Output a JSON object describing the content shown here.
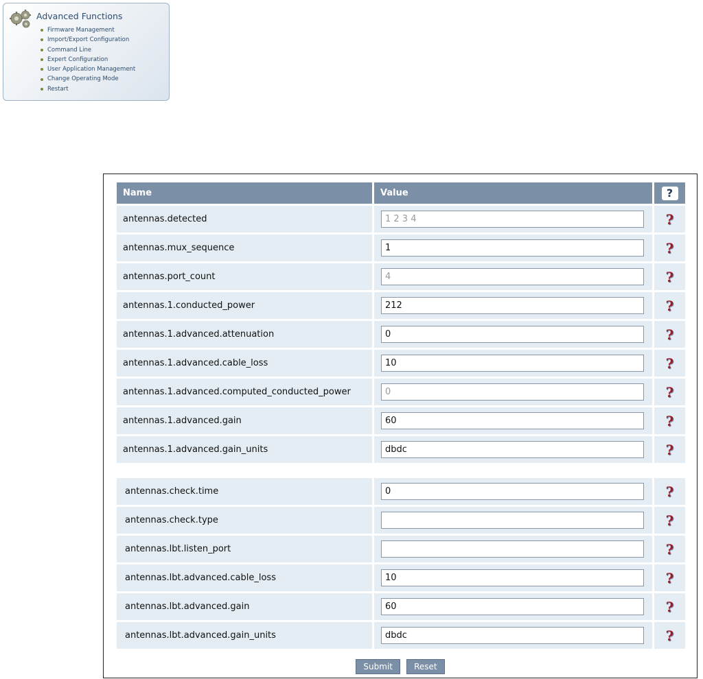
{
  "advanced_functions": {
    "title": "Advanced Functions",
    "items": [
      "Firmware Management",
      "Import/Export Configuration",
      "Command Line",
      "Expert Configuration",
      "User Application Management",
      "Change Operating Mode",
      "Restart"
    ],
    "icon": "gear-icon"
  },
  "table": {
    "headers": {
      "name": "Name",
      "value": "Value",
      "help": "?"
    },
    "rows": [
      {
        "name": "antennas.detected",
        "value": "1 2 3 4",
        "readonly": true
      },
      {
        "name": "antennas.mux_sequence",
        "value": "1",
        "readonly": false
      },
      {
        "name": "antennas.port_count",
        "value": "4",
        "readonly": true
      },
      {
        "name": "antennas.1.conducted_power",
        "value": "212",
        "readonly": false
      },
      {
        "name": "antennas.1.advanced.attenuation",
        "value": "0",
        "readonly": false
      },
      {
        "name": "antennas.1.advanced.cable_loss",
        "value": "10",
        "readonly": false
      },
      {
        "name": "antennas.1.advanced.computed_conducted_power",
        "value": "0",
        "readonly": true
      },
      {
        "name": "antennas.1.advanced.gain",
        "value": "60",
        "readonly": false
      },
      {
        "name": "antennas.1.advanced.gain_units",
        "value": "dbdc",
        "readonly": false
      }
    ],
    "rows2": [
      {
        "name": "antennas.check.time",
        "value": "0",
        "readonly": false
      },
      {
        "name": "antennas.check.type",
        "value": "",
        "readonly": false
      },
      {
        "name": "antennas.lbt.listen_port",
        "value": "",
        "readonly": false
      },
      {
        "name": "antennas.lbt.advanced.cable_loss",
        "value": "10",
        "readonly": false
      },
      {
        "name": "antennas.lbt.advanced.gain",
        "value": "60",
        "readonly": false
      },
      {
        "name": "antennas.lbt.advanced.gain_units",
        "value": "dbdc",
        "readonly": false
      }
    ],
    "help_mark": "?"
  },
  "buttons": {
    "submit": "Submit",
    "reset": "Reset"
  },
  "colors": {
    "header_bg": "#7b8fa6",
    "row_bg": "#e4edf3",
    "help_mark": "#9c1c2c"
  }
}
